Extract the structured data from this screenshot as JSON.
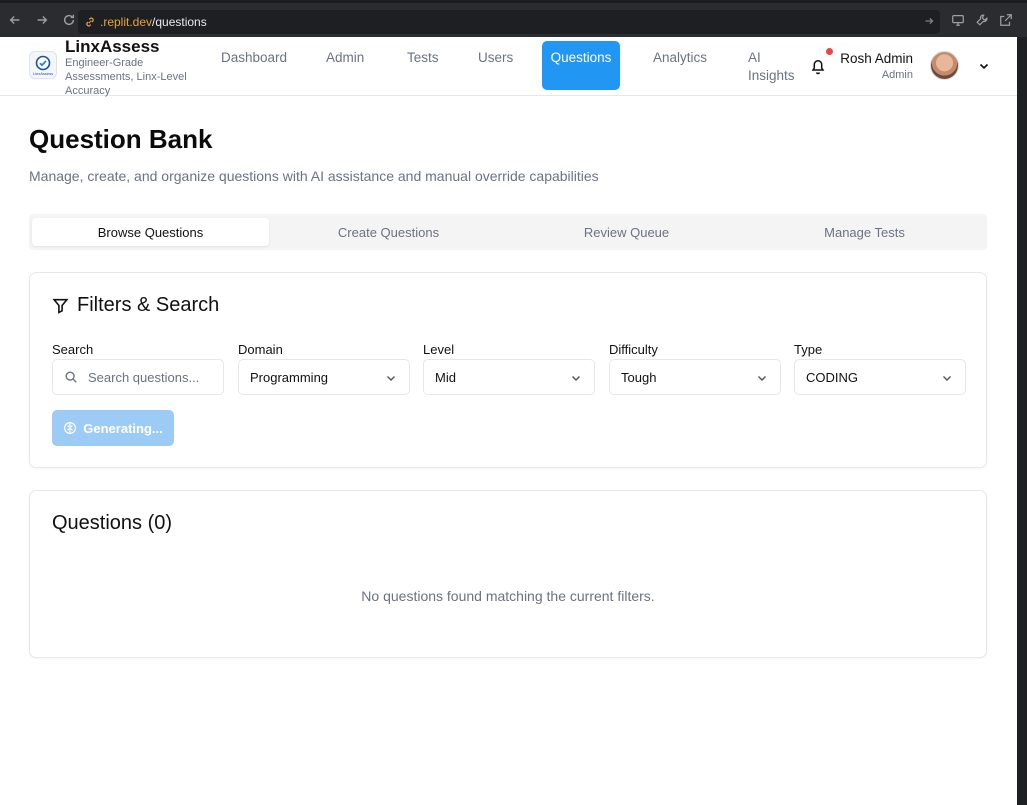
{
  "browser": {
    "url_host": ".replit.dev",
    "url_path": "/questions"
  },
  "brand": {
    "name": "LinxAssess",
    "tagline": "Engineer-Grade Assessments, Linx-Level Accuracy",
    "logo_text": "LinxAssess"
  },
  "nav": {
    "items": [
      {
        "label": "Dashboard"
      },
      {
        "label": "Admin"
      },
      {
        "label": "Tests"
      },
      {
        "label": "Users"
      },
      {
        "label": "Questions",
        "active": true
      },
      {
        "label": "Analytics"
      },
      {
        "label": "AI Insights"
      }
    ]
  },
  "user": {
    "name": "Rosh Admin",
    "role": "Admin"
  },
  "page": {
    "title": "Question Bank",
    "subtitle": "Manage, create, and organize questions with AI assistance and manual override capabilities"
  },
  "tabs": [
    {
      "label": "Browse Questions",
      "active": true
    },
    {
      "label": "Create Questions"
    },
    {
      "label": "Review Queue"
    },
    {
      "label": "Manage Tests"
    }
  ],
  "filters": {
    "title": "Filters & Search",
    "search": {
      "label": "Search",
      "placeholder": "Search questions...",
      "value": ""
    },
    "domain": {
      "label": "Domain",
      "value": "Programming"
    },
    "level": {
      "label": "Level",
      "value": "Mid"
    },
    "difficulty": {
      "label": "Difficulty",
      "value": "Tough"
    },
    "type": {
      "label": "Type",
      "value": "CODING"
    },
    "generate_button": "Generating..."
  },
  "questions": {
    "title": "Questions (0)",
    "empty_message": "No questions found matching the current filters."
  },
  "colors": {
    "primary": "#2196f3",
    "primary_disabled": "#9ccbf6",
    "notification_dot": "#ef4444",
    "url_host": "#e8a33d"
  }
}
